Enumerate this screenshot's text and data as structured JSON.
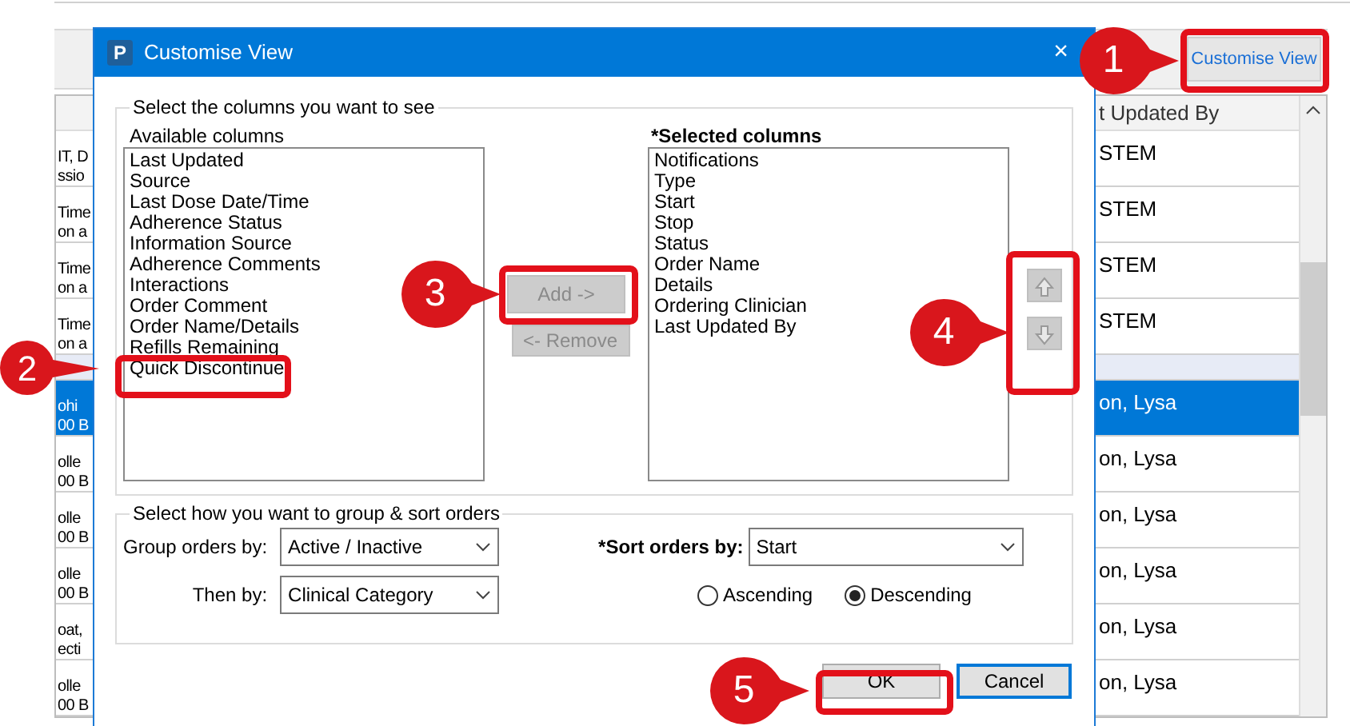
{
  "background": {
    "toolbar": {
      "button": "Customise View"
    },
    "table": {
      "column_header": "t Updated By",
      "rows": [
        {
          "kind": "row",
          "left": [
            "IT, D",
            "ssio"
          ],
          "right": "STEM",
          "selected": false
        },
        {
          "kind": "row",
          "left": [
            "Time",
            "on a"
          ],
          "right": "STEM",
          "selected": false
        },
        {
          "kind": "row",
          "left": [
            "Time",
            "on a"
          ],
          "right": "STEM",
          "selected": false
        },
        {
          "kind": "row",
          "left": [
            "Time",
            "on a"
          ],
          "right": "STEM",
          "selected": false
        },
        {
          "kind": "group"
        },
        {
          "kind": "row",
          "left": [
            "ohi",
            "00 B"
          ],
          "right": "on, Lysa",
          "selected": true
        },
        {
          "kind": "row",
          "left": [
            "olle",
            "00 B"
          ],
          "right": "on, Lysa",
          "selected": false
        },
        {
          "kind": "row",
          "left": [
            "olle",
            "00 B"
          ],
          "right": "on, Lysa",
          "selected": false
        },
        {
          "kind": "row",
          "left": [
            "olle",
            "00 B"
          ],
          "right": "on, Lysa",
          "selected": false
        },
        {
          "kind": "row",
          "left": [
            "oat,",
            "ecti"
          ],
          "right": "on, Lysa",
          "selected": false
        },
        {
          "kind": "row",
          "left": [
            "olle",
            "00 B"
          ],
          "right": "on, Lysa",
          "selected": false
        }
      ]
    }
  },
  "dialog": {
    "logo": "P",
    "title": "Customise View",
    "close": "×",
    "columns_group": {
      "legend": "Select the columns you want to see",
      "available": {
        "label": "Available columns",
        "items": [
          "Last Updated",
          "Source",
          "Last Dose Date/Time",
          "Adherence Status",
          "Information Source",
          "Adherence Comments",
          "Interactions",
          "Order Comment",
          "Order Name/Details",
          "Refills Remaining",
          "Quick Discontinue"
        ]
      },
      "add_button": {
        "label": "Add ->",
        "disabled": true
      },
      "remove_button": {
        "label": "<- Remove",
        "disabled": true
      },
      "selected": {
        "label": "*Selected columns",
        "items": [
          "Notifications",
          "Type",
          "Start",
          "Stop",
          "Status",
          "Order Name",
          "Details",
          "Ordering Clinician",
          "Last Updated By"
        ]
      },
      "move_up": {
        "disabled": true
      },
      "move_down": {
        "disabled": true
      }
    },
    "sort_group": {
      "legend": "Select how you want to group & sort orders",
      "group_by": {
        "label": "Group orders by:",
        "value": "Active / Inactive"
      },
      "then_by": {
        "label": "Then by:",
        "value": "Clinical Category"
      },
      "sort_by": {
        "label": "*Sort orders by:",
        "value": "Start"
      },
      "order": [
        {
          "label": "Ascending",
          "selected": false
        },
        {
          "label": "Descending",
          "selected": true
        }
      ]
    },
    "ok": "OK",
    "cancel": "Cancel"
  },
  "callouts": [
    "1",
    "2",
    "3",
    "4",
    "5"
  ]
}
